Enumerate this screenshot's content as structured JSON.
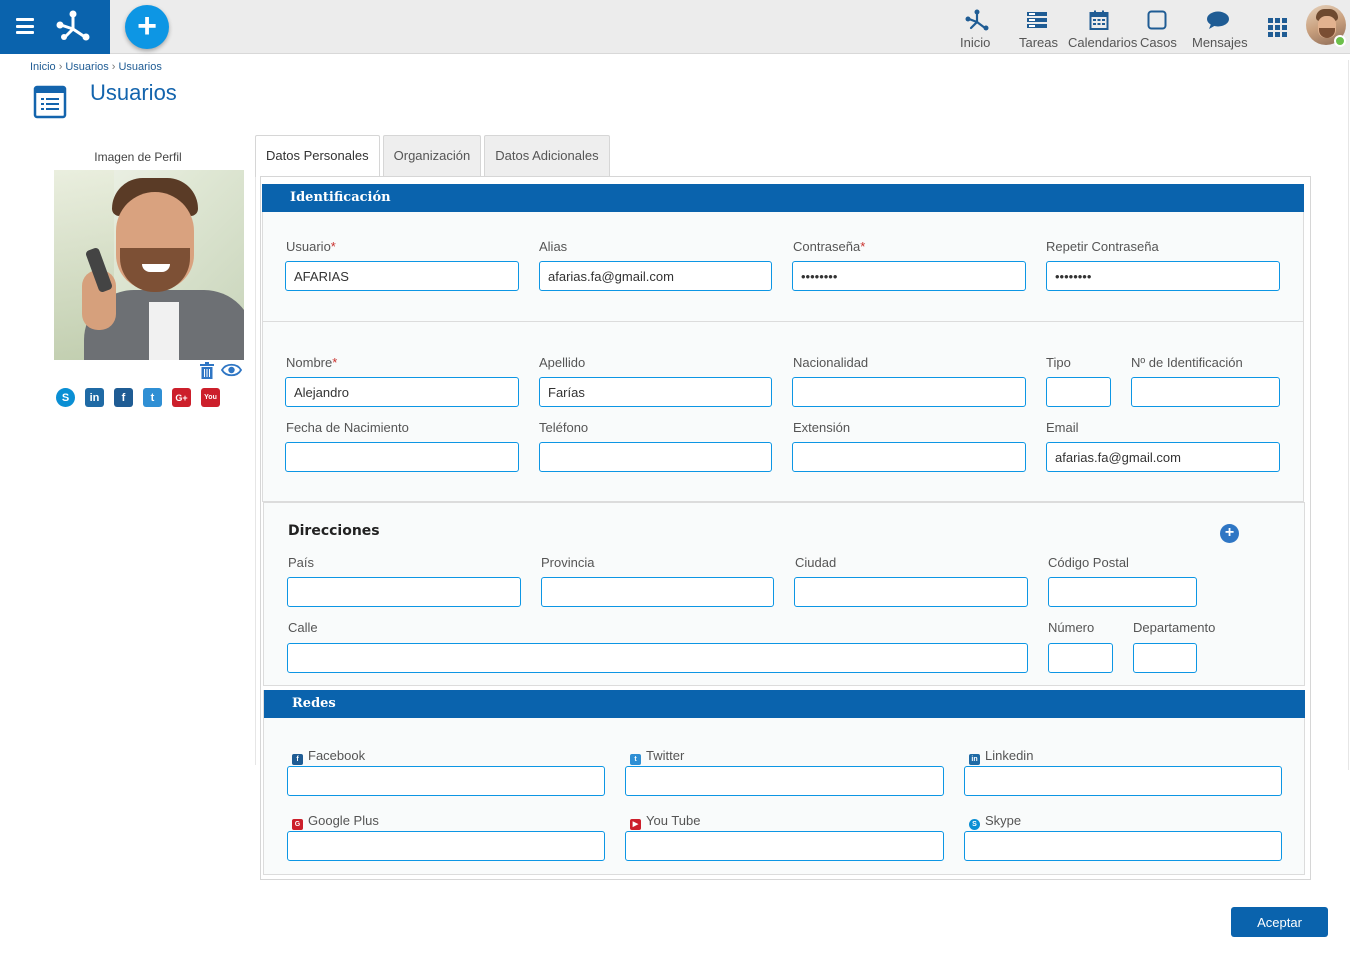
{
  "header": {
    "nav": [
      {
        "id": "inicio",
        "label": "Inicio",
        "icon": "process-icon"
      },
      {
        "id": "tareas",
        "label": "Tareas",
        "icon": "tasks-icon"
      },
      {
        "id": "calendarios",
        "label": "Calendarios",
        "icon": "calendar-icon"
      },
      {
        "id": "casos",
        "label": "Casos",
        "icon": "cases-icon"
      },
      {
        "id": "mensajes",
        "label": "Mensajes",
        "icon": "chat-icon"
      }
    ],
    "add_label": "+",
    "colors": {
      "brand": "#0a63ad",
      "accent": "#0d96e4",
      "online": "#6cc04a"
    }
  },
  "breadcrumb": [
    "Inicio",
    "Usuarios",
    "Usuarios"
  ],
  "page": {
    "title": "Usuarios"
  },
  "profile": {
    "title": "Imagen de Perfil",
    "social": [
      {
        "name": "skype",
        "glyph": "S",
        "color": "#0a8fd4"
      },
      {
        "name": "linkedin",
        "glyph": "in",
        "color": "#1f6aa5"
      },
      {
        "name": "facebook",
        "glyph": "f",
        "color": "#1f5c94"
      },
      {
        "name": "twitter",
        "glyph": "t",
        "color": "#2f8fd4"
      },
      {
        "name": "google-plus",
        "glyph": "G+",
        "color": "#cc1f2b"
      },
      {
        "name": "youtube",
        "glyph": "You",
        "color": "#cc1f2b"
      }
    ]
  },
  "tabs": [
    "Datos Personales",
    "Organización",
    "Datos Adicionales"
  ],
  "identificacion": {
    "title": "Identificación",
    "usuario": {
      "label": "Usuario",
      "value": "AFARIAS"
    },
    "alias": {
      "label": "Alias",
      "value": "afarias.fa@gmail.com"
    },
    "contrasena": {
      "label": "Contraseña",
      "value": "••••••••"
    },
    "repetir": {
      "label": "Repetir Contraseña",
      "value": "••••••••"
    },
    "nombre": {
      "label": "Nombre",
      "value": "Alejandro"
    },
    "apellido": {
      "label": "Apellido",
      "value": "Farías"
    },
    "nacionalidad": {
      "label": "Nacionalidad",
      "value": ""
    },
    "tipo": {
      "label": "Tipo",
      "value": ""
    },
    "nro_id": {
      "label": "Nº de Identificación",
      "value": ""
    },
    "nacimiento": {
      "label": "Fecha de Nacimiento",
      "value": ""
    },
    "telefono": {
      "label": "Teléfono",
      "value": ""
    },
    "extension": {
      "label": "Extensión",
      "value": ""
    },
    "email": {
      "label": "Email",
      "value": "afarias.fa@gmail.com"
    },
    "required_mark": "*"
  },
  "direcciones": {
    "title": "Direcciones",
    "pais": {
      "label": "País",
      "value": ""
    },
    "provincia": {
      "label": "Provincia",
      "value": ""
    },
    "ciudad": {
      "label": "Ciudad",
      "value": ""
    },
    "codigo_postal": {
      "label": "Código Postal",
      "value": ""
    },
    "calle": {
      "label": "Calle",
      "value": ""
    },
    "numero": {
      "label": "Número",
      "value": ""
    },
    "departamento": {
      "label": "Departamento",
      "value": ""
    }
  },
  "redes": {
    "title": "Redes",
    "facebook": {
      "label": "Facebook",
      "value": ""
    },
    "twitter": {
      "label": "Twitter",
      "value": ""
    },
    "linkedin": {
      "label": "Linkedin",
      "value": ""
    },
    "googleplus": {
      "label": "Google Plus",
      "value": ""
    },
    "youtube": {
      "label": "You Tube",
      "value": ""
    },
    "skype": {
      "label": "Skype",
      "value": ""
    }
  },
  "actions": {
    "accept": "Aceptar"
  }
}
